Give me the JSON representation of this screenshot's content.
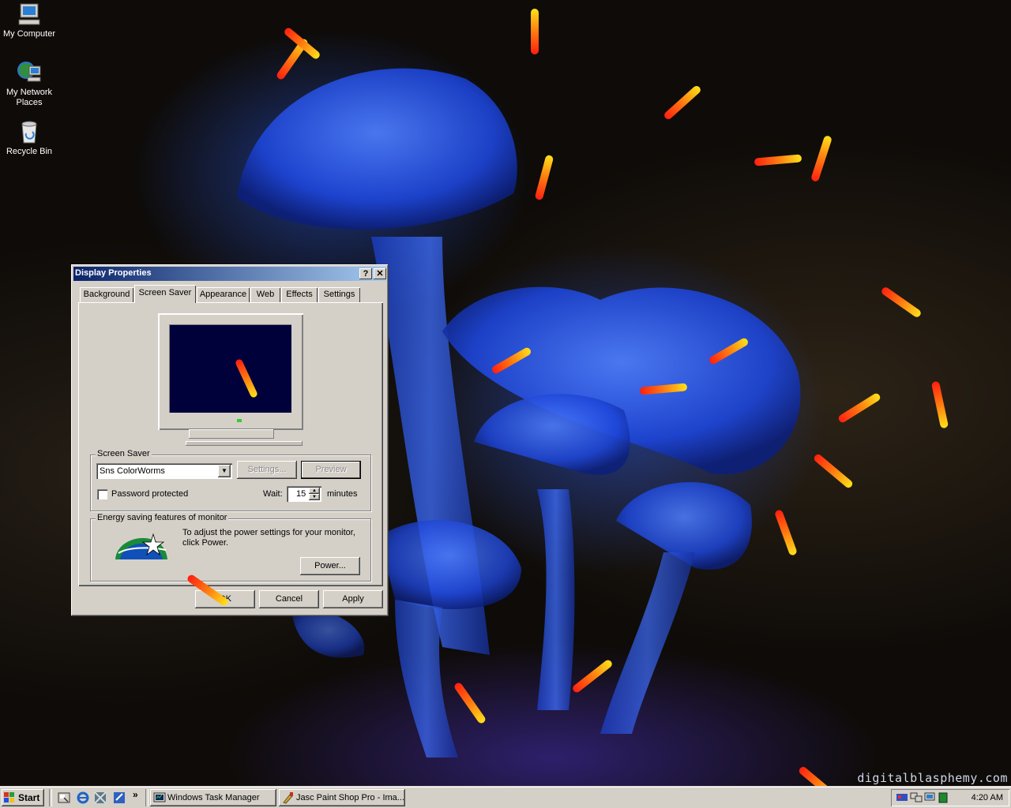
{
  "desktop": {
    "icons": [
      {
        "label": "My Computer",
        "icon": "my-computer-icon"
      },
      {
        "label": "My Network Places",
        "icon": "network-places-icon"
      },
      {
        "label": "Recycle Bin",
        "icon": "recycle-bin-icon"
      }
    ],
    "watermark": "digitalblasphemy.com"
  },
  "dialog": {
    "title": "Display Properties",
    "help_label": "?",
    "close_label": "✕",
    "tabs": [
      {
        "label": "Background"
      },
      {
        "label": "Screen Saver",
        "active": true
      },
      {
        "label": "Appearance"
      },
      {
        "label": "Web"
      },
      {
        "label": "Effects"
      },
      {
        "label": "Settings"
      }
    ],
    "screen_saver": {
      "group_label": "Screen Saver",
      "selected": "Sns ColorWorms",
      "settings_label": "Settings...",
      "preview_label": "Preview",
      "password_label": "Password protected",
      "password_checked": false,
      "wait_label": "Wait:",
      "wait_value": "15",
      "minutes_label": "minutes"
    },
    "energy": {
      "group_label": "Energy saving features of monitor",
      "description": "To adjust the power settings for your monitor, click Power.",
      "power_label": "Power...",
      "logo": "energy-star-logo"
    },
    "buttons": {
      "ok": "OK",
      "cancel": "Cancel",
      "apply": "Apply"
    }
  },
  "taskbar": {
    "start_label": "Start",
    "chevron": "»",
    "tasks": [
      {
        "label": "Windows Task Manager",
        "icon": "task-manager-icon"
      },
      {
        "label": "Jasc Paint Shop Pro - Ima...",
        "icon": "paint-shop-pro-icon"
      }
    ],
    "clock": "4:20 AM"
  }
}
